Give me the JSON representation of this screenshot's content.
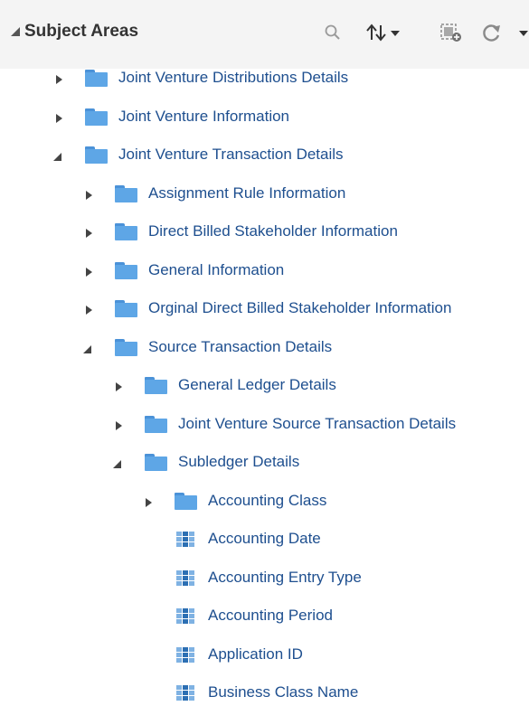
{
  "header": {
    "title": "Subject Areas"
  },
  "tree": [
    {
      "label": "Joint Venture Distributions Details",
      "level": 0,
      "kind": "folder",
      "state": "closed"
    },
    {
      "label": "Joint Venture Information",
      "level": 0,
      "kind": "folder",
      "state": "closed"
    },
    {
      "label": "Joint Venture Transaction Details",
      "level": 0,
      "kind": "folder",
      "state": "open"
    },
    {
      "label": "Assignment Rule Information",
      "level": 1,
      "kind": "folder",
      "state": "closed"
    },
    {
      "label": "Direct Billed Stakeholder Information",
      "level": 1,
      "kind": "folder",
      "state": "closed"
    },
    {
      "label": "General Information",
      "level": 1,
      "kind": "folder",
      "state": "closed"
    },
    {
      "label": "Orginal Direct Billed Stakeholder Information",
      "level": 1,
      "kind": "folder",
      "state": "closed"
    },
    {
      "label": "Source Transaction Details",
      "level": 1,
      "kind": "folder",
      "state": "open"
    },
    {
      "label": "General Ledger Details",
      "level": 2,
      "kind": "folder",
      "state": "closed"
    },
    {
      "label": "Joint Venture Source Transaction Details",
      "level": 2,
      "kind": "folder",
      "state": "closed"
    },
    {
      "label": "Subledger Details",
      "level": 2,
      "kind": "folder",
      "state": "open"
    },
    {
      "label": "Accounting Class",
      "level": 3,
      "kind": "folder",
      "state": "closed"
    },
    {
      "label": "Accounting Date",
      "level": 3,
      "kind": "column"
    },
    {
      "label": "Accounting Entry Type",
      "level": 3,
      "kind": "column"
    },
    {
      "label": "Accounting Period",
      "level": 3,
      "kind": "column"
    },
    {
      "label": "Application ID",
      "level": 3,
      "kind": "column"
    },
    {
      "label": "Business Class Name",
      "level": 3,
      "kind": "column"
    }
  ]
}
